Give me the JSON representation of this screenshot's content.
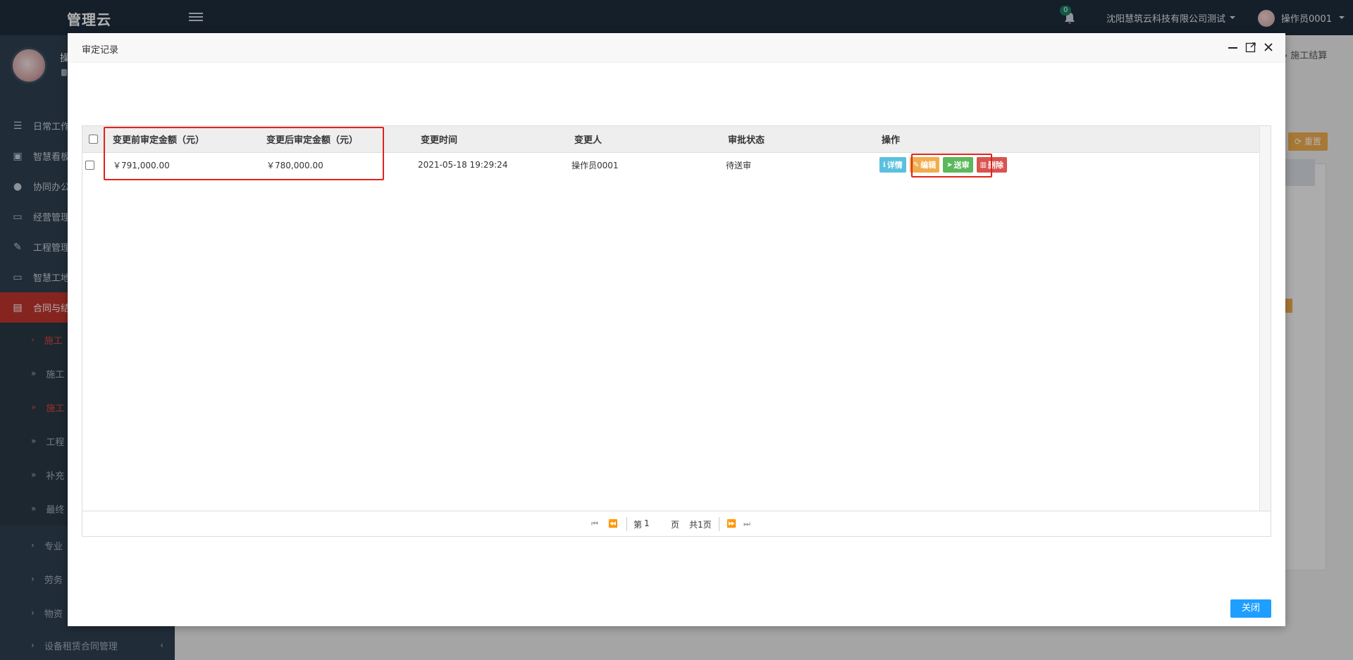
{
  "app": {
    "brand": "管理云",
    "notifications_count": "0",
    "org_name": "沈阳慧筑云科技有限公司测试",
    "user_name": "操作员0001"
  },
  "sidebar": {
    "username_partial": "操",
    "items": [
      {
        "label": "日常工作",
        "icon": "list-icon"
      },
      {
        "label": "智慧看板",
        "icon": "dashboard-icon"
      },
      {
        "label": "协同办公",
        "icon": "users-icon"
      },
      {
        "label": "经营管理",
        "icon": "monitor-icon"
      },
      {
        "label": "工程管理",
        "icon": "gavel-icon"
      },
      {
        "label": "智慧工地",
        "icon": "monitor-icon"
      },
      {
        "label": "合同与结",
        "icon": "file-icon"
      }
    ],
    "subitems": [
      {
        "label": "施工",
        "chev": "›"
      },
      {
        "label": "施工",
        "chev": "»"
      },
      {
        "label": "施工",
        "chev": "»"
      },
      {
        "label": "工程",
        "chev": "»"
      },
      {
        "label": "补充",
        "chev": "»"
      },
      {
        "label": "最终",
        "chev": "»"
      },
      {
        "label": "专业",
        "chev": "›"
      },
      {
        "label": "劳务",
        "chev": "›"
      },
      {
        "label": "物资",
        "chev": "›"
      },
      {
        "label": "设备租赁合同管理",
        "chev": "›"
      }
    ]
  },
  "background": {
    "breadcrumb": "施工结算",
    "reset_label": "重置"
  },
  "modal": {
    "title": "审定记录",
    "close_label": "关闭"
  },
  "table": {
    "headers": [
      "变更前审定金额（元）",
      "变更后审定金额（元）",
      "变更时间",
      "变更人",
      "审批状态",
      "操作"
    ],
    "rows": [
      {
        "before": "￥791,000.00",
        "after": "￥780,000.00",
        "time": "2021-05-18 19:29:24",
        "person": "操作员0001",
        "status": "待送审"
      }
    ],
    "actions": {
      "detail": "详情",
      "edit": "编辑",
      "submit": "送审",
      "delete": "删除"
    }
  },
  "pager": {
    "page_prefix": "第",
    "page_value": "1",
    "page_suffix": "页",
    "total": "共1页"
  },
  "colors": {
    "navbar": "#1f2d3d",
    "sidebar": "#2f4050",
    "active": "#c1352e",
    "highlight": "#e0231b",
    "primary_button": "#1e9fff"
  }
}
